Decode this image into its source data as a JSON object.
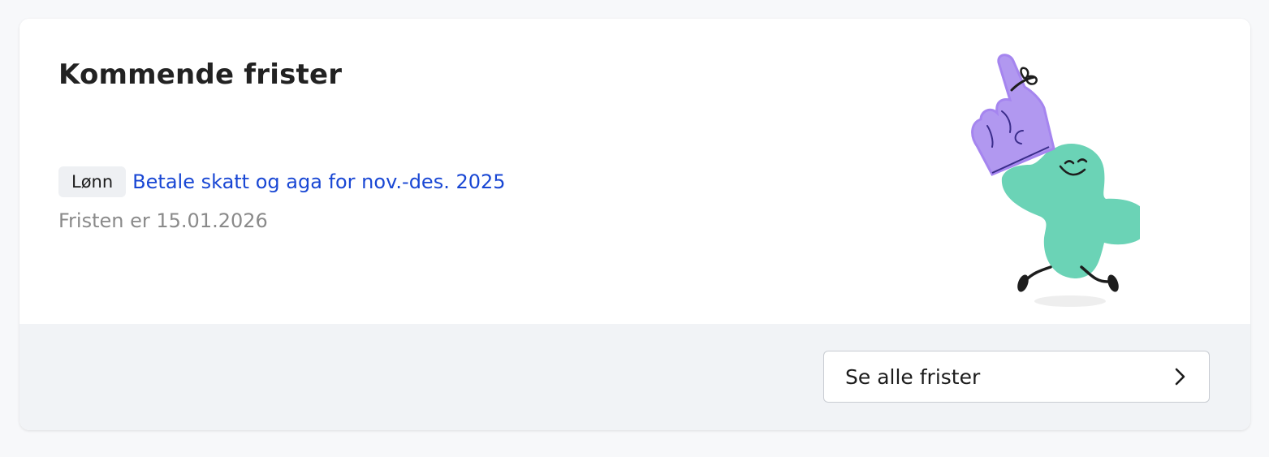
{
  "card": {
    "title": "Kommende frister"
  },
  "deadlines": [
    {
      "category": "Lønn",
      "title": "Betale skatt og aga for nov.-des. 2025",
      "due_text": "Fristen er 15.01.2026"
    }
  ],
  "footer": {
    "button_label": "Se alle frister",
    "button_icon": "chevron-right-icon"
  },
  "illustration": {
    "icon": "foam-finger-mascot-illustration"
  },
  "colors": {
    "background": "#f7f8fa",
    "card": "#ffffff",
    "footer": "#f1f3f6",
    "link": "#1947d4",
    "muted_text": "#8a8a8a",
    "tag_background": "#eef0f3",
    "mascot_green": "#6bd3b6",
    "finger_purple": "#b198f0"
  }
}
